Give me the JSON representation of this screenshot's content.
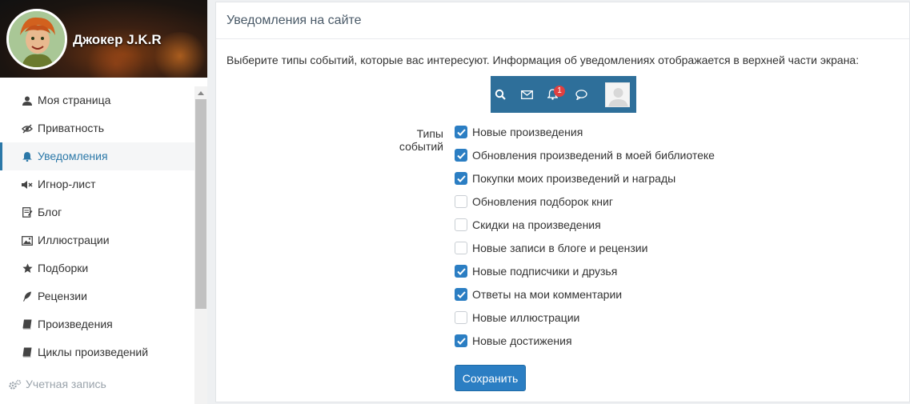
{
  "profile": {
    "name": "Джокер J.K.R"
  },
  "sidebar": {
    "items": [
      {
        "label": "Моя страница",
        "icon": "user-icon",
        "active": false
      },
      {
        "label": "Приватность",
        "icon": "eye-slash-icon",
        "active": false
      },
      {
        "label": "Уведомления",
        "icon": "bell-icon",
        "active": true
      },
      {
        "label": "Игнор-лист",
        "icon": "volume-off-icon",
        "active": false
      },
      {
        "label": "Блог",
        "icon": "edit-note-icon",
        "active": false
      },
      {
        "label": "Иллюстрации",
        "icon": "image-icon",
        "active": false
      },
      {
        "label": "Подборки",
        "icon": "star-icon",
        "active": false
      },
      {
        "label": "Рецензии",
        "icon": "feather-icon",
        "active": false
      },
      {
        "label": "Произведения",
        "icon": "book-icon",
        "active": false
      },
      {
        "label": "Циклы произведений",
        "icon": "book-icon",
        "active": false
      }
    ],
    "account": {
      "label": "Учетная запись",
      "icon": "gears-icon"
    }
  },
  "panel": {
    "title": "Уведомления на сайте",
    "intro": "Выберите типы событий, которые вас интересуют. Информация об уведомлениях отображается в верхней части экрана:",
    "preview": {
      "badge": "1"
    },
    "types_label": "Типы событий",
    "options": [
      {
        "label": "Новые произведения",
        "checked": true
      },
      {
        "label": "Обновления произведений в моей библиотеке",
        "checked": true
      },
      {
        "label": "Покупки моих произведений и награды",
        "checked": true
      },
      {
        "label": "Обновления подборок книг",
        "checked": false
      },
      {
        "label": "Скидки на произведения",
        "checked": false
      },
      {
        "label": "Новые записи в блоге и рецензии",
        "checked": false
      },
      {
        "label": "Новые подписчики и друзья",
        "checked": true
      },
      {
        "label": "Ответы на мои комментарии",
        "checked": true
      },
      {
        "label": "Новые иллюстрации",
        "checked": false
      },
      {
        "label": "Новые достижения",
        "checked": true
      }
    ],
    "save_label": "Сохранить"
  },
  "colors": {
    "accent": "#2b7ec3",
    "active_menu": "#2b78a8",
    "preview_bar": "#2e6f9a",
    "badge": "#e04040"
  }
}
